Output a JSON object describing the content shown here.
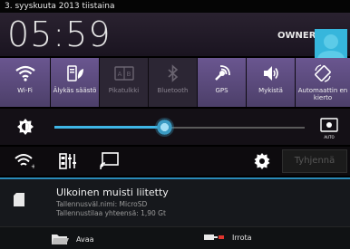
{
  "status_bar": {
    "date": "3. syyskuuta 2013 tiistaina"
  },
  "header": {
    "time": "05:59",
    "user": "OWNER"
  },
  "toggles": [
    {
      "label": "Wi-Fi",
      "icon": "wifi-icon",
      "state": "on"
    },
    {
      "label": "Älykäs säästö",
      "icon": "smart-save-icon",
      "state": "on"
    },
    {
      "label": "Pikatulkki",
      "icon": "quick-translator-icon",
      "state": "off"
    },
    {
      "label": "Bluetooth",
      "icon": "bluetooth-icon",
      "state": "off"
    },
    {
      "label": "GPS",
      "icon": "gps-icon",
      "state": "on"
    },
    {
      "label": "Mykistä",
      "icon": "mute-icon",
      "state": "on"
    },
    {
      "label": "Automaattin en kierto",
      "icon": "auto-rotate-icon",
      "state": "on"
    }
  ],
  "brightness": {
    "level_fraction": 0.44,
    "auto_label": "AUTO"
  },
  "quick_row": {
    "clear_label": "Tyhjennä"
  },
  "notification": {
    "title": "Ulkoinen muisti liitetty",
    "line1": "Tallennusväl.nimi: MicroSD",
    "line2": "Tallennustilaa yhteensä: 1,90 Gt",
    "actions": [
      {
        "label": "Avaa",
        "icon": "folder-icon"
      },
      {
        "label": "Irrota",
        "icon": "unmount-icon"
      }
    ]
  },
  "colors": {
    "accent": "#3fb6e6",
    "toggle_on": "#5a4a7c",
    "avatar": "#36b6dc"
  }
}
